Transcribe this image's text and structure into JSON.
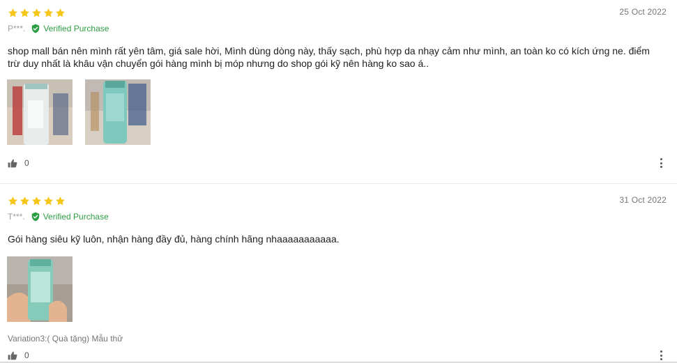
{
  "colors": {
    "star": "#f5c518",
    "verified": "#2e9e44",
    "muted": "#757575",
    "text": "#212121"
  },
  "reviews": [
    {
      "rating": 5,
      "date": "25 Oct 2022",
      "reviewer": "P***.",
      "verified_label": "Verified Purchase",
      "verified_icon": "shield-check-icon",
      "text": "shop mall bán nên mình rất yên tâm, giá sale hời, Mình dùng dòng này, thấy sạch, phù hợp da nhạy cảm như mình, an toàn ko có kích ứng ne. điểm trừ duy nhất là khâu vận chuyển gói hàng mình bị móp nhưng do shop gói kỹ nên hàng ko sao á..",
      "photos": [
        "product-photo-bottle-back",
        "product-photo-bottle-front"
      ],
      "variation": "",
      "likes": "0",
      "like_icon": "thumbs-up-icon",
      "more_icon": "more-vertical-icon"
    },
    {
      "rating": 5,
      "date": "31 Oct 2022",
      "reviewer": "T***.",
      "verified_label": "Verified Purchase",
      "verified_icon": "shield-check-icon",
      "text": "Gói hàng siêu kỹ luôn, nhận hàng đầy đủ, hàng chính hãng nhaaaaaaaaaaa.",
      "photos": [
        "product-photo-bottle-in-hand"
      ],
      "variation": "Variation3:( Quà tặng) Mẫu thử",
      "likes": "0",
      "like_icon": "thumbs-up-icon",
      "more_icon": "more-vertical-icon"
    }
  ]
}
